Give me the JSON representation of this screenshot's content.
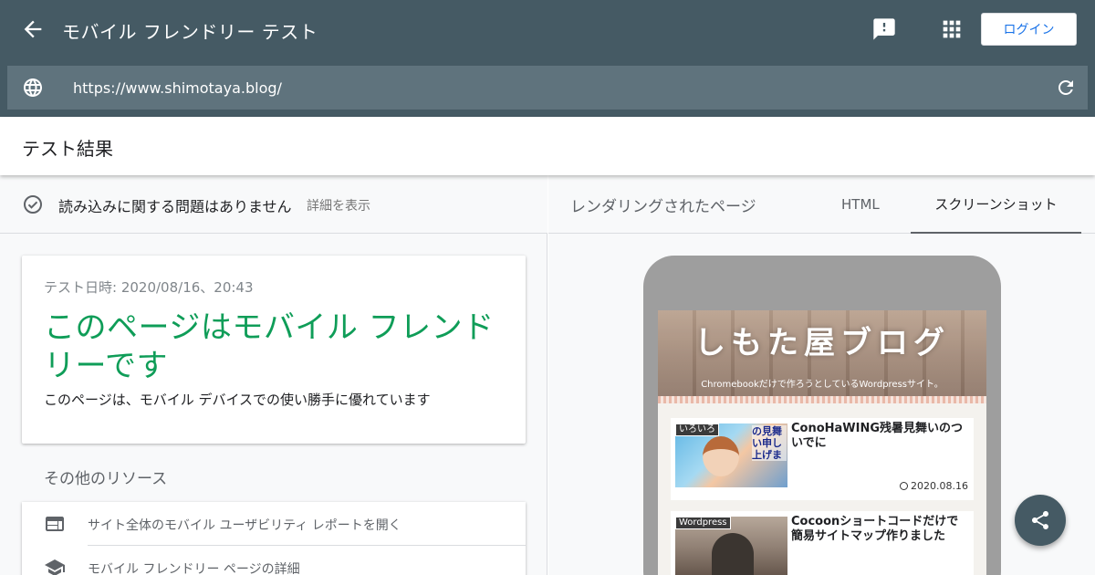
{
  "appbar": {
    "title": "モバイル フレンドリー テスト",
    "login_label": "ログイン"
  },
  "urlbar": {
    "url": "https://www.shimotaya.blog/"
  },
  "results": {
    "title": "テスト結果"
  },
  "status": {
    "text": "読み込みに関する問題はありません",
    "details_link": "詳細を表示"
  },
  "result_card": {
    "date": "テスト日時: 2020/08/16、20:43",
    "heading": "このページはモバイル フレンドリーです",
    "description": "このページは、モバイル デバイスでの使い勝手に優れています"
  },
  "other_resources": {
    "title": "その他のリソース",
    "items": [
      {
        "label": "サイト全体のモバイル ユーザビリティ レポートを開く",
        "icon": "web-icon"
      },
      {
        "label": "モバイル フレンドリー ページの詳細",
        "icon": "school-icon"
      }
    ]
  },
  "tabs": [
    {
      "label": "レンダリングされたページ"
    },
    {
      "label": "HTML"
    },
    {
      "label": "スクリーンショット",
      "selected": true
    }
  ],
  "preview": {
    "blog_title": "しもた屋ブログ",
    "blog_tagline": "Chromebookだけで作ろうとしているWordpressサイト。",
    "posts": [
      {
        "category": "いろいろ",
        "title": "ConoHaWING残暑見舞いのついでに",
        "date": "2020.08.16",
        "thumb_caption": "の見舞い申し上げま"
      },
      {
        "category": "Wordpress",
        "title": "Cocoonショートコードだけで簡易サイトマップ作りました",
        "date": ""
      }
    ]
  },
  "colors": {
    "appbar": "#455a64",
    "urlbar": "#5f737d",
    "friendly_green": "#0f9d58",
    "login_text": "#1a73e8"
  }
}
